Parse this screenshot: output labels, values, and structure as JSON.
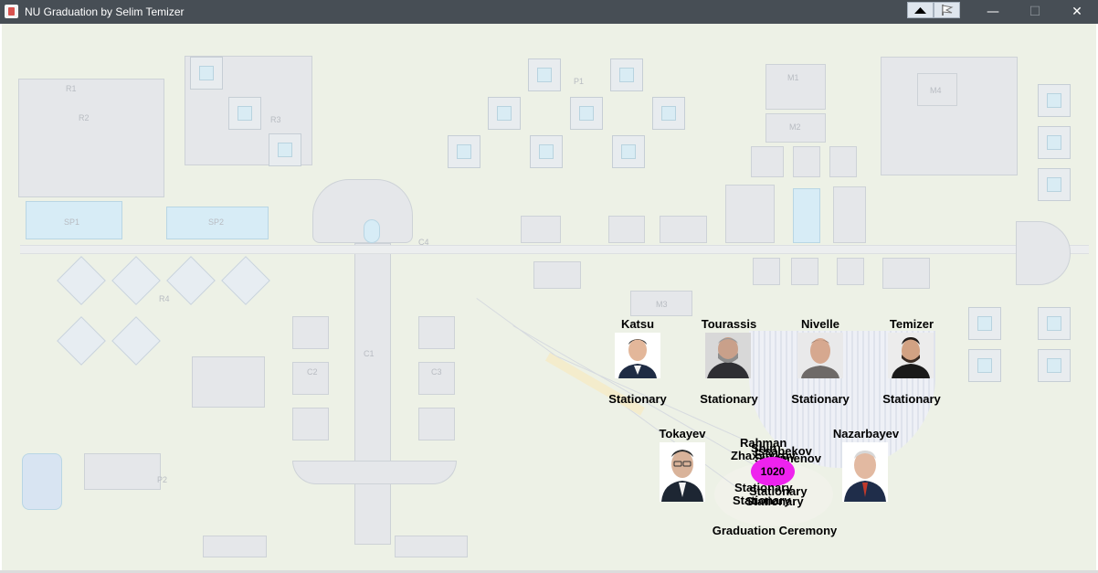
{
  "window": {
    "title": "NU Graduation by Selim Temizer",
    "toolbar_icons": [
      "speed-up-icon",
      "flag-icon"
    ],
    "controls": {
      "minimize": "—",
      "maximize": "☐",
      "close": "✕"
    }
  },
  "map": {
    "labels": [
      "SP1",
      "SP2",
      "R1",
      "R2",
      "R3",
      "R4",
      "P1",
      "P2",
      "M1",
      "M2",
      "M3",
      "M4",
      "C1",
      "C2",
      "C3",
      "C4"
    ]
  },
  "agents": {
    "stationary_status": "Stationary",
    "top_row": [
      {
        "name": "Katsu",
        "status": "Stationary"
      },
      {
        "name": "Tourassis",
        "status": "Stationary"
      },
      {
        "name": "Nivelle",
        "status": "Stationary"
      },
      {
        "name": "Temizer",
        "status": "Stationary"
      }
    ],
    "tokayev": {
      "name": "Tokayev"
    },
    "nazarbayev": {
      "name": "Nazarbayev"
    }
  },
  "ceremony": {
    "label": "Graduation Ceremony",
    "crowd_count": "1020",
    "overlap_names": [
      "Rahman",
      "Zhaxylykov",
      "Shin",
      "Suleimenov",
      "Issabekov"
    ],
    "overlap_status": "Stationary",
    "colors": {
      "crowd": "#ee22ee"
    }
  }
}
